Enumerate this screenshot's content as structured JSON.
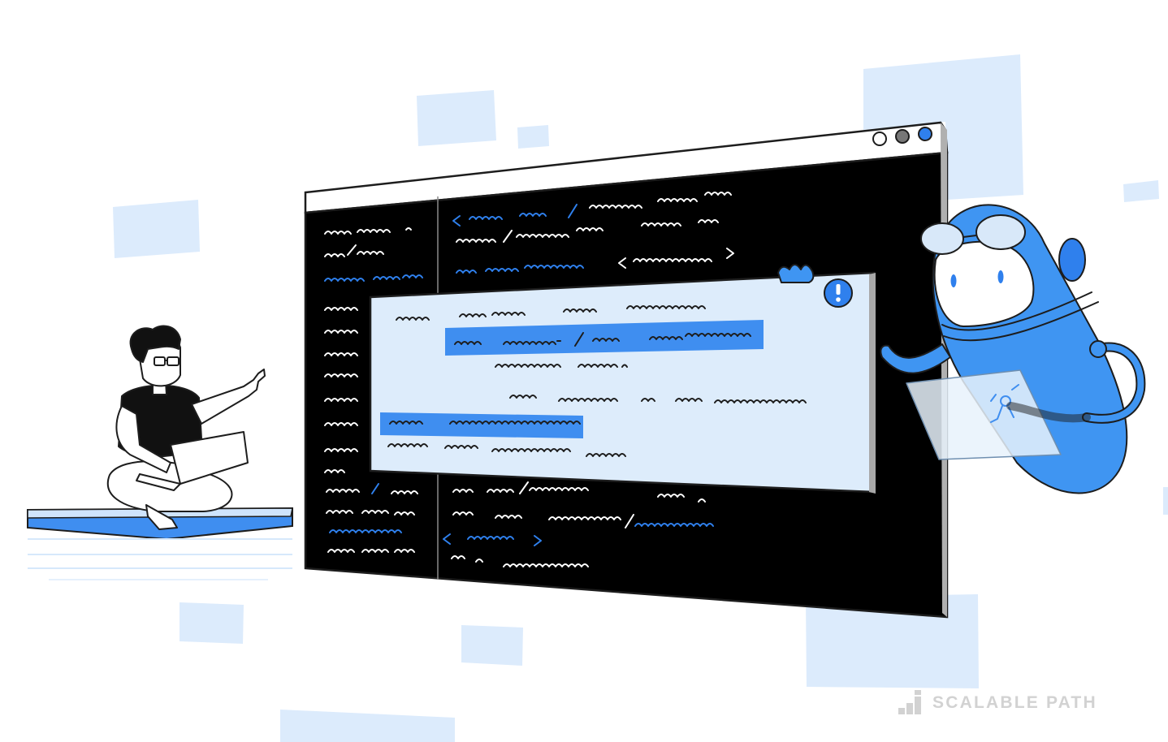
{
  "brand": {
    "name": "SCALABLE PATH",
    "logo_icon": "bar-steps-logo-icon"
  },
  "colors": {
    "accent": "#2f80ed",
    "light_accent": "#d9eafc",
    "window_body": "#000000",
    "popup_bg": "#ddecfb",
    "robot_blue": "#3f95f2",
    "logo_gray": "#d2d2d2"
  },
  "window": {
    "title_bar_dots": [
      "white",
      "gray",
      "blue"
    ],
    "alert_icon": "exclamation-icon"
  },
  "people": {
    "developer": "person-with-laptop",
    "robot": "robot-with-goggles"
  }
}
